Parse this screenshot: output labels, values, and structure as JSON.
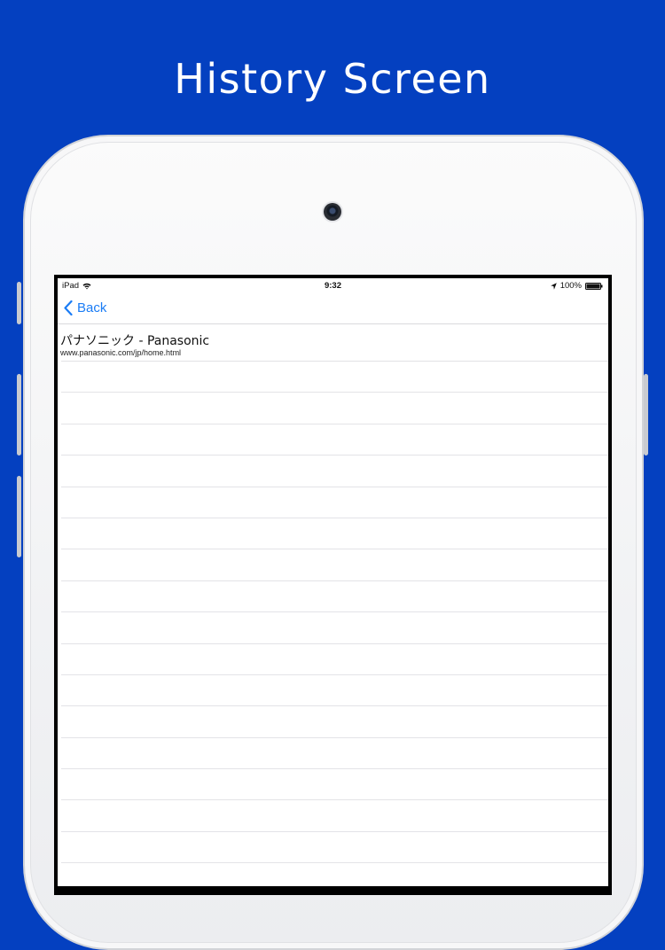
{
  "headline": "History Screen",
  "status_bar": {
    "device": "iPad",
    "time": "9:32",
    "battery": "100%"
  },
  "nav": {
    "back_label": "Back"
  },
  "history": [
    {
      "title": "パナソニック - Panasonic",
      "url": "www.panasonic.com/jp/home.html"
    }
  ],
  "icons": {
    "wifi": "wifi-icon",
    "location": "location-arrow-icon",
    "battery": "battery-icon",
    "back": "chevron-left-icon",
    "camera": "camera-icon"
  },
  "colors": {
    "background": "#0440c0",
    "accent": "#1a7cf5"
  }
}
